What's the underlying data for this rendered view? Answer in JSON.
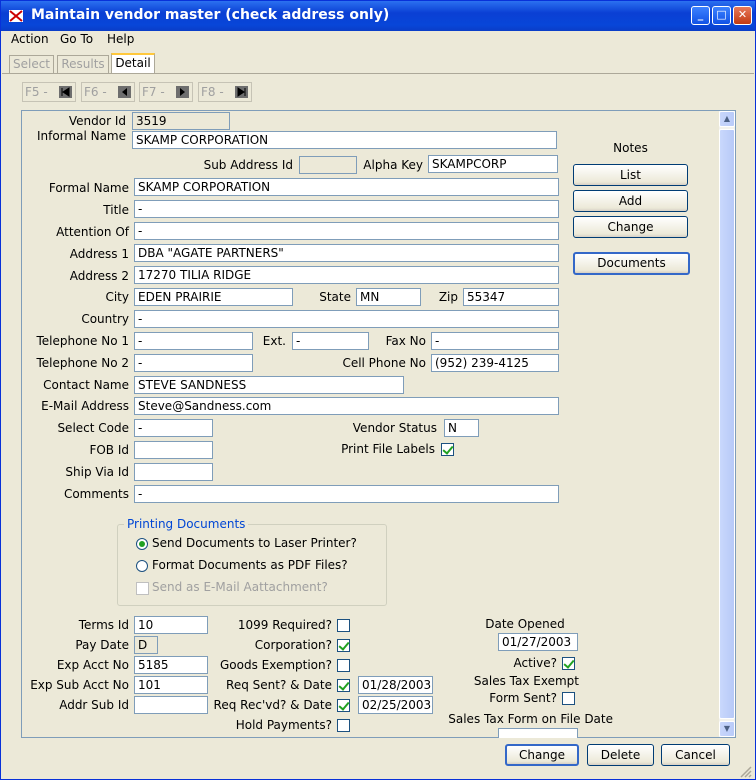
{
  "window": {
    "title": "Maintain vendor master  (check address only)",
    "min_label": "_",
    "max_label": "□",
    "close_label": "✕"
  },
  "menu": [
    {
      "label": "Action"
    },
    {
      "label": "Go To"
    },
    {
      "label": "Help"
    }
  ],
  "tabs": [
    {
      "label": "Select"
    },
    {
      "label": "Results"
    },
    {
      "label": "Detail"
    }
  ],
  "fkeys": [
    {
      "label": "F5 -"
    },
    {
      "label": "F6 -"
    },
    {
      "label": "F7 -"
    },
    {
      "label": "F8 -"
    }
  ],
  "labels": {
    "vendor_id": "Vendor Id",
    "informal_name": "Informal Name",
    "sub_address_id": "Sub Address Id",
    "alpha_key": "Alpha Key",
    "formal_name": "Formal Name",
    "title": "Title",
    "attention_of": "Attention Of",
    "address1": "Address 1",
    "address2": "Address 2",
    "city": "City",
    "state": "State",
    "zip": "Zip",
    "country": "Country",
    "telephone1": "Telephone No 1",
    "ext": "Ext.",
    "fax": "Fax No",
    "telephone2": "Telephone No 2",
    "cell": "Cell Phone No",
    "contact_name": "Contact Name",
    "email": "E-Mail Address",
    "select_code": "Select Code",
    "vendor_status": "Vendor Status",
    "fob_id": "FOB Id",
    "print_file_labels": "Print File Labels",
    "ship_via": "Ship Via Id",
    "comments": "Comments",
    "terms_id": "Terms Id",
    "pay_date": "Pay Date",
    "exp_acct": "Exp Acct No",
    "exp_sub_acct": "Exp Sub Acct No",
    "addr_sub_id": "Addr Sub Id",
    "req_1099": "1099 Required?",
    "corporation": "Corporation?",
    "goods_exemption": "Goods Exemption?",
    "req_sent": "Req Sent? & Date",
    "req_recvd": "Req Rec'vd? & Date",
    "hold_payments": "Hold Payments?",
    "date_opened": "Date Opened",
    "active": "Active?",
    "sales_tax_exempt": "Sales Tax Exempt",
    "form_sent": "Form Sent?",
    "sales_tax_form_date": "Sales Tax Form on File Date"
  },
  "values": {
    "vendor_id": "3519",
    "informal_name": "SKAMP CORPORATION",
    "sub_address_id": "",
    "alpha_key": "SKAMPCORP",
    "formal_name": "SKAMP CORPORATION",
    "title": "-",
    "attention_of": "-",
    "address1": "DBA \"AGATE PARTNERS\"",
    "address2": "17270 TILIA RIDGE",
    "city": "EDEN PRAIRIE",
    "state": "MN",
    "zip": "55347",
    "country": "-",
    "telephone1": "-",
    "ext": "-",
    "fax": "-",
    "telephone2": "-",
    "cell": "(952) 239-4125",
    "contact_name": "STEVE SANDNESS",
    "email": "Steve@Sandness.com",
    "select_code": "-",
    "vendor_status": "N",
    "fob_id": "",
    "ship_via": "",
    "comments": "-",
    "terms_id": "10",
    "pay_date": "D",
    "exp_acct": "5185",
    "exp_sub_acct": "101",
    "addr_sub_id": "",
    "req_sent_date": "01/28/2003",
    "req_recvd_date": "02/25/2003",
    "date_opened": "01/27/2003",
    "sales_tax_form_date": ""
  },
  "checks": {
    "print_file_labels": true,
    "req_1099": false,
    "corporation": true,
    "goods_exemption": false,
    "req_sent": true,
    "req_recvd": true,
    "hold_payments": false,
    "active": true,
    "form_sent": false
  },
  "notes": {
    "title": "Notes",
    "list": "List",
    "add": "Add",
    "change": "Change",
    "documents": "Documents"
  },
  "printing": {
    "title": "Printing Documents",
    "opt_laser": "Send Documents to Laser Printer?",
    "opt_pdf": "Format Documents as PDF Files?",
    "opt_email": "Send as E-Mail Aattachment?",
    "selected": "laser"
  },
  "footer": {
    "change": "Change",
    "delete": "Delete",
    "cancel": "Cancel"
  },
  "colors": {
    "titlebar": "#0a3fd4",
    "accent": "#0046d5",
    "check": "#21a121"
  }
}
